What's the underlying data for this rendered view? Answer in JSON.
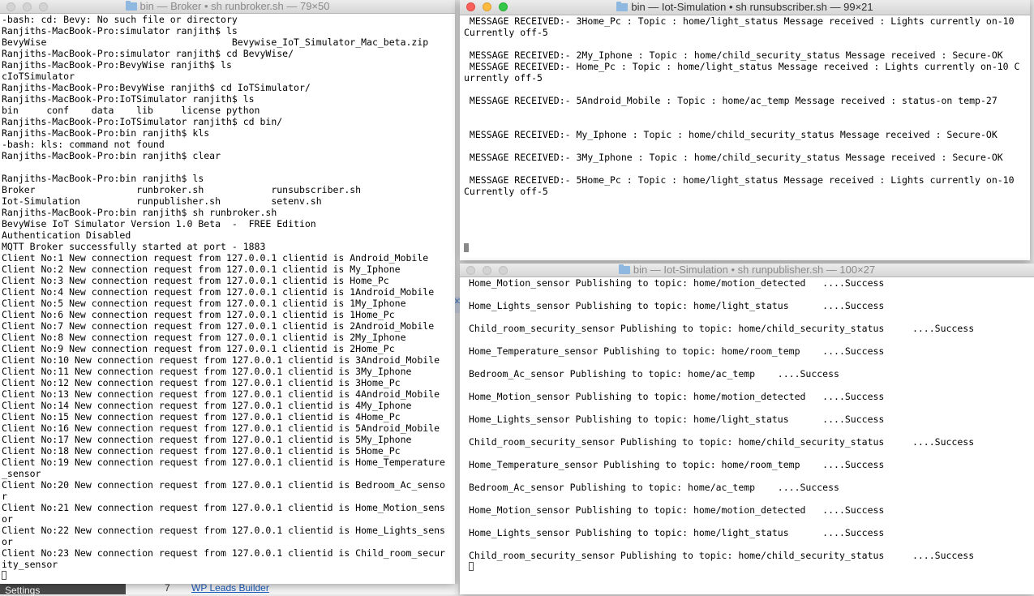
{
  "background": {
    "settings_label": "Settings",
    "list_number": "7",
    "link_text": "WP Leads Builder",
    "tab_fragment": "bo"
  },
  "broker_window": {
    "title": "bin — Broker • sh runbroker.sh — 79×50",
    "lines": [
      "-bash: cd: Bevy: No such file or directory",
      "Ranjiths-MacBook-Pro:simulator ranjith$ ls",
      "BevyWise                                 Bevywise_IoT_Simulator_Mac_beta.zip",
      "Ranjiths-MacBook-Pro:simulator ranjith$ cd BevyWise/",
      "Ranjiths-MacBook-Pro:BevyWise ranjith$ ls",
      "cIoTSimulator",
      "Ranjiths-MacBook-Pro:BevyWise ranjith$ cd IoTSimulator/",
      "Ranjiths-MacBook-Pro:IoTSimulator ranjith$ ls",
      "bin     conf    data    lib     license python",
      "Ranjiths-MacBook-Pro:IoTSimulator ranjith$ cd bin/",
      "Ranjiths-MacBook-Pro:bin ranjith$ kls",
      "-bash: kls: command not found",
      "Ranjiths-MacBook-Pro:bin ranjith$ clear",
      "",
      "Ranjiths-MacBook-Pro:bin ranjith$ ls",
      "Broker                  runbroker.sh            runsubscriber.sh",
      "Iot-Simulation          runpublisher.sh         setenv.sh",
      "Ranjiths-MacBook-Pro:bin ranjith$ sh runbroker.sh",
      "BevyWise IoT Simulator Version 1.0 Beta  -  FREE Edition",
      "Authentication Disabled",
      "MQTT Broker successfully started at port - 1883",
      "Client No:1 New connection request from 127.0.0.1 clientid is Android_Mobile",
      "Client No:2 New connection request from 127.0.0.1 clientid is My_Iphone",
      "Client No:3 New connection request from 127.0.0.1 clientid is Home_Pc",
      "Client No:4 New connection request from 127.0.0.1 clientid is 1Android_Mobile",
      "Client No:5 New connection request from 127.0.0.1 clientid is 1My_Iphone",
      "Client No:6 New connection request from 127.0.0.1 clientid is 1Home_Pc",
      "Client No:7 New connection request from 127.0.0.1 clientid is 2Android_Mobile",
      "Client No:8 New connection request from 127.0.0.1 clientid is 2My_Iphone",
      "Client No:9 New connection request from 127.0.0.1 clientid is 2Home_Pc",
      "Client No:10 New connection request from 127.0.0.1 clientid is 3Android_Mobile",
      "Client No:11 New connection request from 127.0.0.1 clientid is 3My_Iphone",
      "Client No:12 New connection request from 127.0.0.1 clientid is 3Home_Pc",
      "Client No:13 New connection request from 127.0.0.1 clientid is 4Android_Mobile",
      "Client No:14 New connection request from 127.0.0.1 clientid is 4My_Iphone",
      "Client No:15 New connection request from 127.0.0.1 clientid is 4Home_Pc",
      "Client No:16 New connection request from 127.0.0.1 clientid is 5Android_Mobile",
      "Client No:17 New connection request from 127.0.0.1 clientid is 5My_Iphone",
      "Client No:18 New connection request from 127.0.0.1 clientid is 5Home_Pc",
      "Client No:19 New connection request from 127.0.0.1 clientid is Home_Temperature",
      "_sensor",
      "Client No:20 New connection request from 127.0.0.1 clientid is Bedroom_Ac_senso",
      "r",
      "Client No:21 New connection request from 127.0.0.1 clientid is Home_Motion_sens",
      "or",
      "Client No:22 New connection request from 127.0.0.1 clientid is Home_Lights_sens",
      "or",
      "Client No:23 New connection request from 127.0.0.1 clientid is Child_room_secur",
      "ity_sensor"
    ]
  },
  "subscriber_window": {
    "title": "bin — Iot-Simulation • sh runsubscriber.sh — 99×21",
    "lines": [
      " MESSAGE RECEIVED:- 3Home_Pc : Topic : home/light_status Message received : Lights currently on-10",
      "Currently off-5",
      "",
      " MESSAGE RECEIVED:- 2My_Iphone : Topic : home/child_security_status Message received : Secure-OK",
      " MESSAGE RECEIVED:- Home_Pc : Topic : home/light_status Message received : Lights currently on-10 C",
      "urrently off-5",
      "",
      " MESSAGE RECEIVED:- 5Android_Mobile : Topic : home/ac_temp Message received : status-on temp-27",
      "",
      "",
      " MESSAGE RECEIVED:- My_Iphone : Topic : home/child_security_status Message received : Secure-OK",
      "",
      " MESSAGE RECEIVED:- 3My_Iphone : Topic : home/child_security_status Message received : Secure-OK",
      "",
      " MESSAGE RECEIVED:- 5Home_Pc : Topic : home/light_status Message received : Lights currently on-10",
      "Currently off-5"
    ]
  },
  "publisher_window": {
    "title": "bin — Iot-Simulation • sh runpublisher.sh — 100×27",
    "lines": [
      "Home_Motion_sensor Publishing to topic: home/motion_detected   ....Success",
      "",
      "Home_Lights_sensor Publishing to topic: home/light_status      ....Success",
      "",
      "Child_room_security_sensor Publishing to topic: home/child_security_status     ....Success",
      "",
      "Home_Temperature_sensor Publishing to topic: home/room_temp    ....Success",
      "",
      "Bedroom_Ac_sensor Publishing to topic: home/ac_temp    ....Success",
      "",
      "Home_Motion_sensor Publishing to topic: home/motion_detected   ....Success",
      "",
      "Home_Lights_sensor Publishing to topic: home/light_status      ....Success",
      "",
      "Child_room_security_sensor Publishing to topic: home/child_security_status     ....Success",
      "",
      "Home_Temperature_sensor Publishing to topic: home/room_temp    ....Success",
      "",
      "Bedroom_Ac_sensor Publishing to topic: home/ac_temp    ....Success",
      "",
      "Home_Motion_sensor Publishing to topic: home/motion_detected   ....Success",
      "",
      "Home_Lights_sensor Publishing to topic: home/light_status      ....Success",
      "",
      "Child_room_security_sensor Publishing to topic: home/child_security_status     ....Success"
    ]
  }
}
